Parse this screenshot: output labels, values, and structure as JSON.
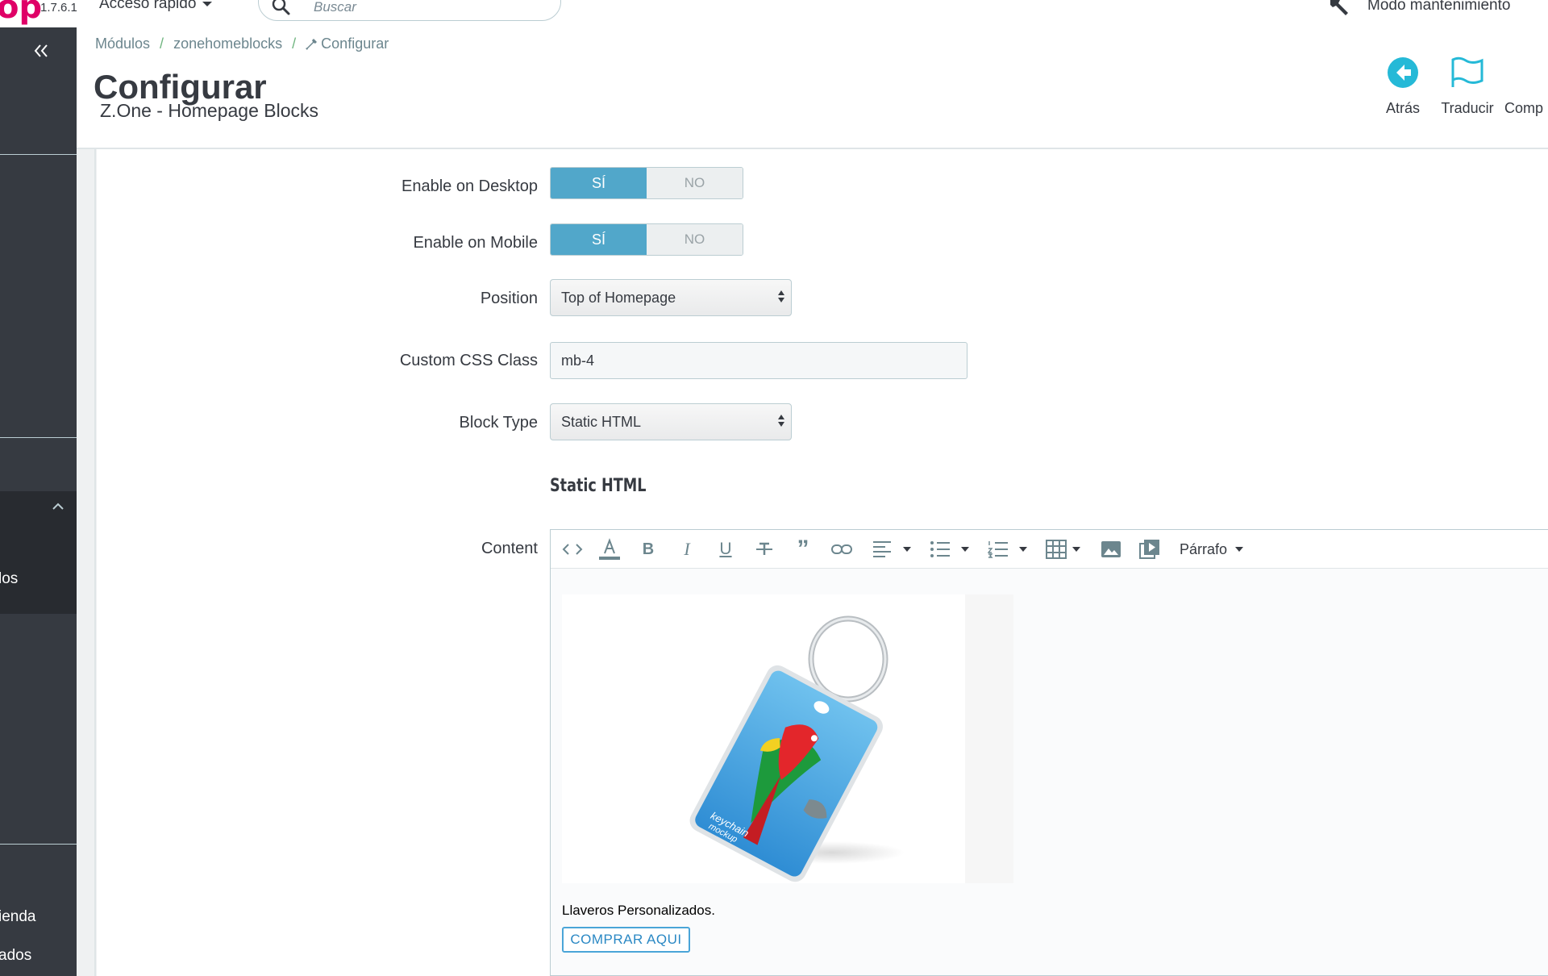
{
  "topbar": {
    "logo_text": "op",
    "version": "1.7.6.1",
    "quick_access_label": "Acceso rápido",
    "search_placeholder": "Buscar",
    "maintenance_label": "Modo mantenimiento"
  },
  "sidebar": {
    "collapse_label": "«",
    "item_texts": [
      "los",
      "ienda",
      "ados"
    ]
  },
  "breadcrumb": [
    "Módulos",
    "zonehomeblocks",
    "Configurar"
  ],
  "page": {
    "title": "Configurar",
    "subtitle": "Z.One - Homepage Blocks"
  },
  "header_actions": [
    {
      "label": "Atrás",
      "icon": "back-arrow-icon"
    },
    {
      "label": "Traducir",
      "icon": "flag-icon"
    },
    {
      "label": "Comp",
      "icon": "unknown"
    }
  ],
  "form": {
    "enable_desktop": {
      "label": "Enable on Desktop",
      "yes": "SÍ",
      "no": "NO",
      "value": "SÍ"
    },
    "enable_mobile": {
      "label": "Enable on Mobile",
      "yes": "SÍ",
      "no": "NO",
      "value": "SÍ"
    },
    "position": {
      "label": "Position",
      "value": "Top of Homepage"
    },
    "custom_css": {
      "label": "Custom CSS Class",
      "value": "mb-4"
    },
    "block_type": {
      "label": "Block Type",
      "value": "Static HTML"
    },
    "section_title": "Static HTML",
    "content_label": "Content"
  },
  "editor": {
    "toolbar_icons": [
      "code-icon",
      "text-color-icon",
      "bold-icon",
      "italic-icon",
      "underline-icon",
      "strikethrough-icon",
      "blockquote-icon",
      "link-icon",
      "align-icon",
      "bullet-list-icon",
      "numbered-list-icon",
      "table-icon",
      "image-icon",
      "media-icon"
    ],
    "paragraph_format": "Párrafo",
    "image_text": [
      "keychain",
      "mockup"
    ],
    "body_text": "Llaveros Personalizados.",
    "button_label": "COMPRAR AQUI"
  },
  "colors": {
    "brand": "#df0067",
    "switch_on": "#51a7ca",
    "sidebar": "#363a41",
    "sidebar_active": "#282b30",
    "breadcrumb_separator": "#70b580",
    "link_blue": "#2a88c4"
  }
}
